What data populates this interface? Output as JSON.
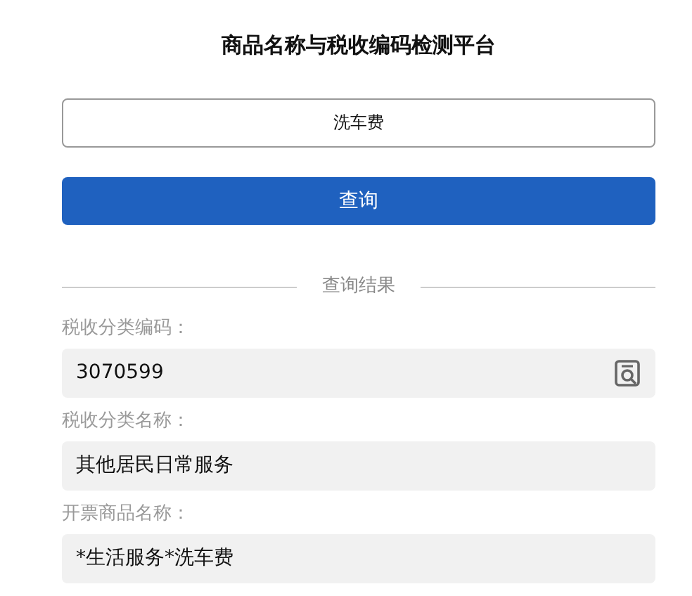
{
  "title": "商品名称与税收编码检测平台",
  "search": {
    "value": "洗车费"
  },
  "button": "查询",
  "divider": "查询结果",
  "results": [
    {
      "label": "税收分类编码：",
      "value": "3070599",
      "has_lookup": true
    },
    {
      "label": "税收分类名称：",
      "value": "其他居民日常服务",
      "has_lookup": false
    },
    {
      "label": "开票商品名称：",
      "value": "*生活服务*洗车费",
      "has_lookup": false
    }
  ]
}
